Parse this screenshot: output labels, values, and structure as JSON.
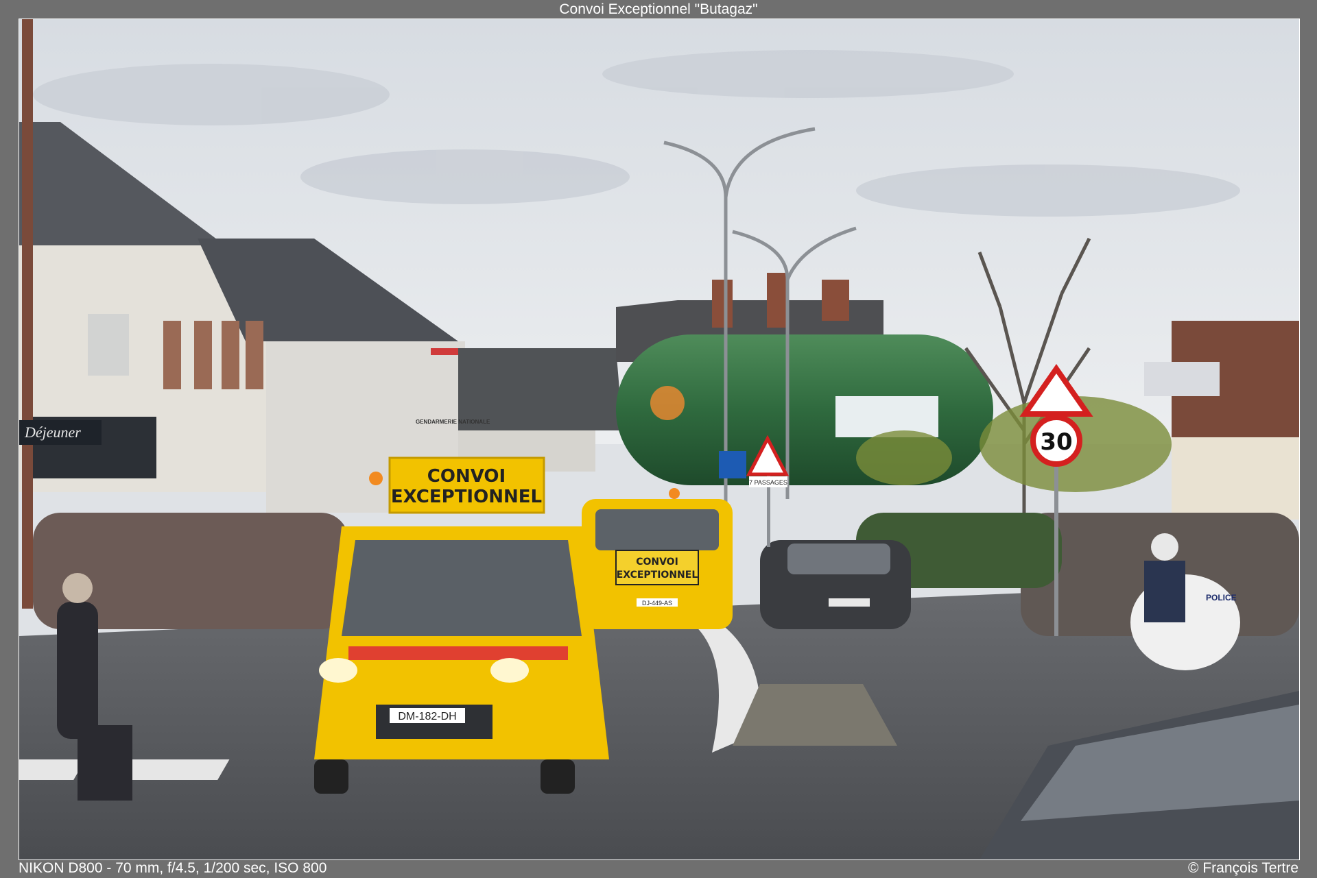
{
  "frame": {
    "title": "Convoi Exceptionnel \"Butagaz\"",
    "exif": "NIKON D800 - 70 mm, f/4.5, 1/200 sec, ISO 800",
    "copyright": "© François Tertre"
  },
  "photo": {
    "front_vehicle_sign": [
      "CONVOI",
      "EXCEPTIONNEL"
    ],
    "second_vehicle_sign": [
      "CONVOI",
      "EXCEPTIONNEL"
    ],
    "front_plate": "DM-182-DH",
    "second_plate": "DJ-449-AS",
    "speed_limit": "30",
    "crossing_sign_caption": "7 PASSAGES",
    "police_label": "POLICE",
    "gendarmerie_label": "GENDARMERIE NATIONALE",
    "shop_sign": "Déjeuner"
  },
  "colors": {
    "sky": "#dfe2e6",
    "tank_green": "#2f6a3e",
    "vehicle_yellow": "#f2c200",
    "road": "#5a5c5f"
  }
}
